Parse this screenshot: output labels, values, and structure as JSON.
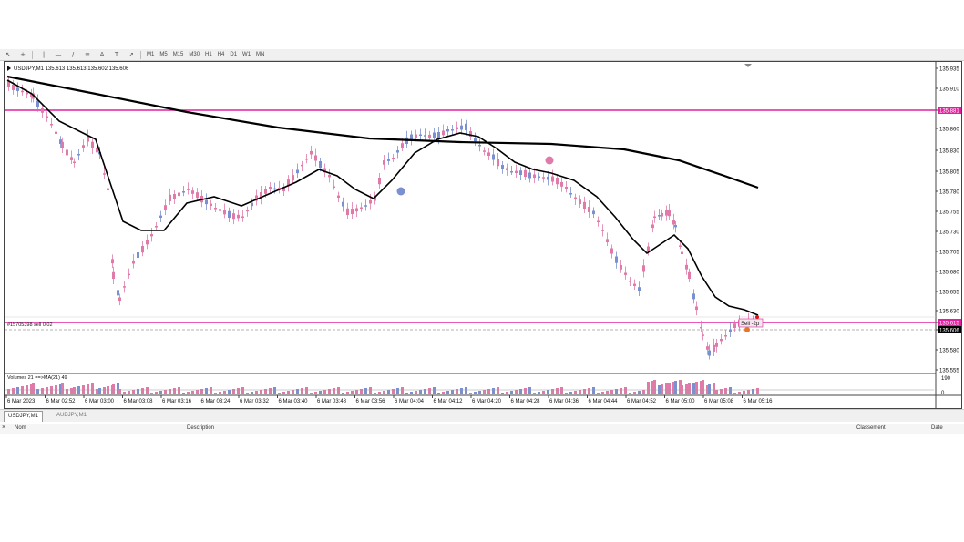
{
  "toolbar": {
    "icons": [
      "cursor-icon",
      "crosshair-icon",
      "vertical-line-icon",
      "horizontal-line-icon",
      "trendline-icon",
      "channel-icon",
      "text-icon",
      "label-icon",
      "arrow-icon"
    ],
    "glyphs": [
      "↖",
      "+",
      "|",
      "—",
      "/",
      "≡",
      "A",
      "T",
      "➚"
    ],
    "timeframes": [
      "M1",
      "M5",
      "M15",
      "M30",
      "H1",
      "H4",
      "D1",
      "W1",
      "MN"
    ]
  },
  "chart": {
    "header": "USDJPY,M1  135.613 135.613 135.602 135.606",
    "order_label": "#15705398 sell 0.02",
    "trade_tag": "Sell -2p",
    "volume_label": "Volumes 21  ==>MA(21) 49",
    "price_axis": [
      "135.935",
      "135.910",
      "135.881",
      "135.860",
      "135.830",
      "135.805",
      "135.780",
      "135.755",
      "135.730",
      "135.705",
      "135.680",
      "135.655",
      "135.630",
      "135.615",
      "135.606",
      "135.580",
      "135.555"
    ],
    "highlight_labels": {
      "resistance": "135.881",
      "order": "135.615",
      "bid": "135.606"
    },
    "volume_axis": [
      "190",
      "0"
    ],
    "time_axis": [
      "6 Mar 2023",
      "6 Mar 02:52",
      "6 Mar 03:00",
      "6 Mar 03:08",
      "6 Mar 03:16",
      "6 Mar 03:24",
      "6 Mar 03:32",
      "6 Mar 03:40",
      "6 Mar 03:48",
      "6 Mar 03:56",
      "6 Mar 04:04",
      "6 Mar 04:12",
      "6 Mar 04:20",
      "6 Mar 04:28",
      "6 Mar 04:36",
      "6 Mar 04:44",
      "6 Mar 04:52",
      "6 Mar 05:00",
      "6 Mar 05:08",
      "6 Mar 05:16"
    ],
    "colors": {
      "bear": "#e07aa8",
      "bull": "#7a90d0",
      "line": "#000000",
      "level": "#e020a0",
      "grid": "#c8c8c8"
    }
  },
  "tabs": [
    "USDJPY,M1",
    "AUDJPY,M1"
  ],
  "terminal": {
    "close": "×",
    "columns": [
      "Nom",
      "Description",
      "Classement",
      "Date"
    ]
  }
}
